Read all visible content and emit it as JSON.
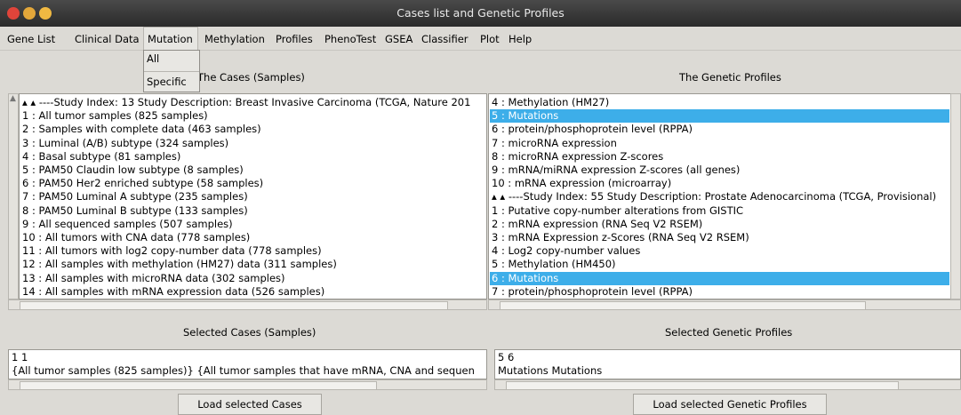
{
  "window": {
    "title": "Cases list and Genetic Profiles"
  },
  "menubar": {
    "items": [
      "Gene List",
      "Clinical Data",
      "Mutation",
      "Methylation",
      "Profiles",
      "PhenoTest",
      "GSEA",
      "Classifier",
      "Plot",
      "Help"
    ],
    "open_menu": "Mutation",
    "mutation_dropdown": [
      "All",
      "Specific"
    ]
  },
  "cases_panel": {
    "heading": "The Cases (Samples)",
    "rows": [
      "▴ ▴ ----Study Index:  13   Study Description:  Breast Invasive Carcinoma (TCGA, Nature 201",
      "1 : All tumor samples (825 samples)",
      "2 : Samples with complete data (463 samples)",
      "3 : Luminal (A/B) subtype (324 samples)",
      "4 : Basal subtype (81 samples)",
      "5 : PAM50 Claudin low subtype (8 samples)",
      "6 : PAM50 Her2 enriched subtype (58 samples)",
      "7 : PAM50 Luminal A subtype (235 samples)",
      "8 : PAM50 Luminal B subtype (133 samples)",
      "9 : All sequenced samples (507 samples)",
      "10 : All tumors with CNA data (778 samples)",
      "11 : All tumors with log2 copy-number data (778 samples)",
      "12 : All samples with methylation (HM27) data (311 samples)",
      "13 : All samples with microRNA data (302 samples)",
      "14 : All samples with mRNA expression data (526 samples)"
    ]
  },
  "profiles_panel": {
    "heading": "The Genetic Profiles",
    "rows": [
      "4 : Methylation (HM27)",
      "5 : Mutations",
      "6 : protein/phosphoprotein level (RPPA)",
      "7 : microRNA expression",
      "8 : microRNA expression Z-scores",
      "9 : mRNA/miRNA expression Z-scores (all genes)",
      "10 : mRNA expression (microarray)",
      "▴ ▴ ----Study Index:  55   Study Description:  Prostate Adenocarcinoma (TCGA, Provisional)",
      "1 : Putative copy-number alterations from GISTIC",
      "2 : mRNA expression (RNA Seq V2 RSEM)",
      "3 : mRNA Expression z-Scores (RNA Seq V2 RSEM)",
      "4 : Log2 copy-number values",
      "5 : Methylation (HM450)",
      "6 : Mutations",
      "7 : protein/phosphoprotein level (RPPA)"
    ],
    "selected_rows": [
      1,
      13
    ]
  },
  "selected_cases": {
    "heading": "Selected Cases (Samples)",
    "line1": "1 1",
    "line2": "{All tumor samples (825 samples)} {All tumor samples that have mRNA, CNA and sequen"
  },
  "selected_profiles": {
    "heading": "Selected Genetic Profiles",
    "line1": "5 6",
    "line2": "Mutations Mutations"
  },
  "buttons": {
    "load_cases": "Load selected Cases",
    "load_profiles": "Load selected Genetic Profiles"
  }
}
